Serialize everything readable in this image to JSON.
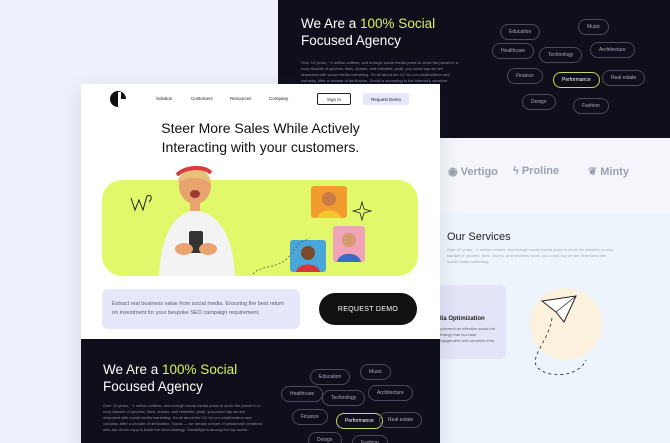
{
  "back_card": {
    "title_pre": "We Are a ",
    "title_highlight": "100% Social",
    "title_post": "Focused Agency",
    "paragraph": "Over 10 years, ~1 million coffees, and enough social media posts to circle the planet in a cozy blanket of upvotes, likes, shares, and retweets; yeah, you could say we are obsessed with social media marketing. It's all about the CC for our collaboration and curiosity. After a decade of dedication, Social is accepting to the internet's constant change.",
    "chips": [
      "Education",
      "Music",
      "Healthcare",
      "Technology",
      "Architecture",
      "Finance",
      "Performance",
      "Real estate",
      "Design",
      "Fashion"
    ],
    "logos": [
      "Vertigo",
      "Proline",
      "Minty"
    ],
    "services_title": "Our Services",
    "services_text": "Over 10 years, ~1 million coffees, and enough social media posts to circle the planet in a cozy blanket of upvotes, likes, shares, and retweets; yeah, you could say we are obsessed with social media marketing.",
    "service_card_title": "dia Optimization",
    "service_card_text": "mplement an effective social ent strategy that increase engagement and connects ents."
  },
  "front_card": {
    "nav": {
      "links": [
        "Solution",
        "Customers",
        "Resources",
        "Company"
      ],
      "signin": "Sign In",
      "request_demo": "Request Demo"
    },
    "hero_title_line1": "Steer More Sales While Actively",
    "hero_title_line2": "Interacting with your customers.",
    "cta_text": "Extract real business value from social media. Ensuring the best return on investment for your bespoke SEO campaign requirement.",
    "cta_button": "REQUEST DEMO",
    "dark": {
      "title_pre": "We Are a ",
      "title_highlight": "100% Social",
      "title_post": "Focused Agency",
      "paragraph": "Over 10 years, ~1 million coffees, and enough social media posts to circle the planet in a cozy blanket of upvotes, likes, shares, and retweets; yeah, you could say we are obsessed with social media marketing. It's all about the CC for our collaboration and curiosity. After a decade of dedication, Social — we remain a team of passionate creatives who are clever copy to tickle the mind strategy. SocialAgh is among the top social.",
      "chips": [
        "Education",
        "Music",
        "Healthcare",
        "Technology",
        "Architecture",
        "Finance",
        "Performance",
        "Real estate",
        "Design",
        "Fashion"
      ]
    }
  },
  "colors": {
    "accent": "#d9f25f",
    "dark_bg": "#0f0f1c",
    "banner": "#e2f86b",
    "soft_purple": "#e6e7fb"
  }
}
